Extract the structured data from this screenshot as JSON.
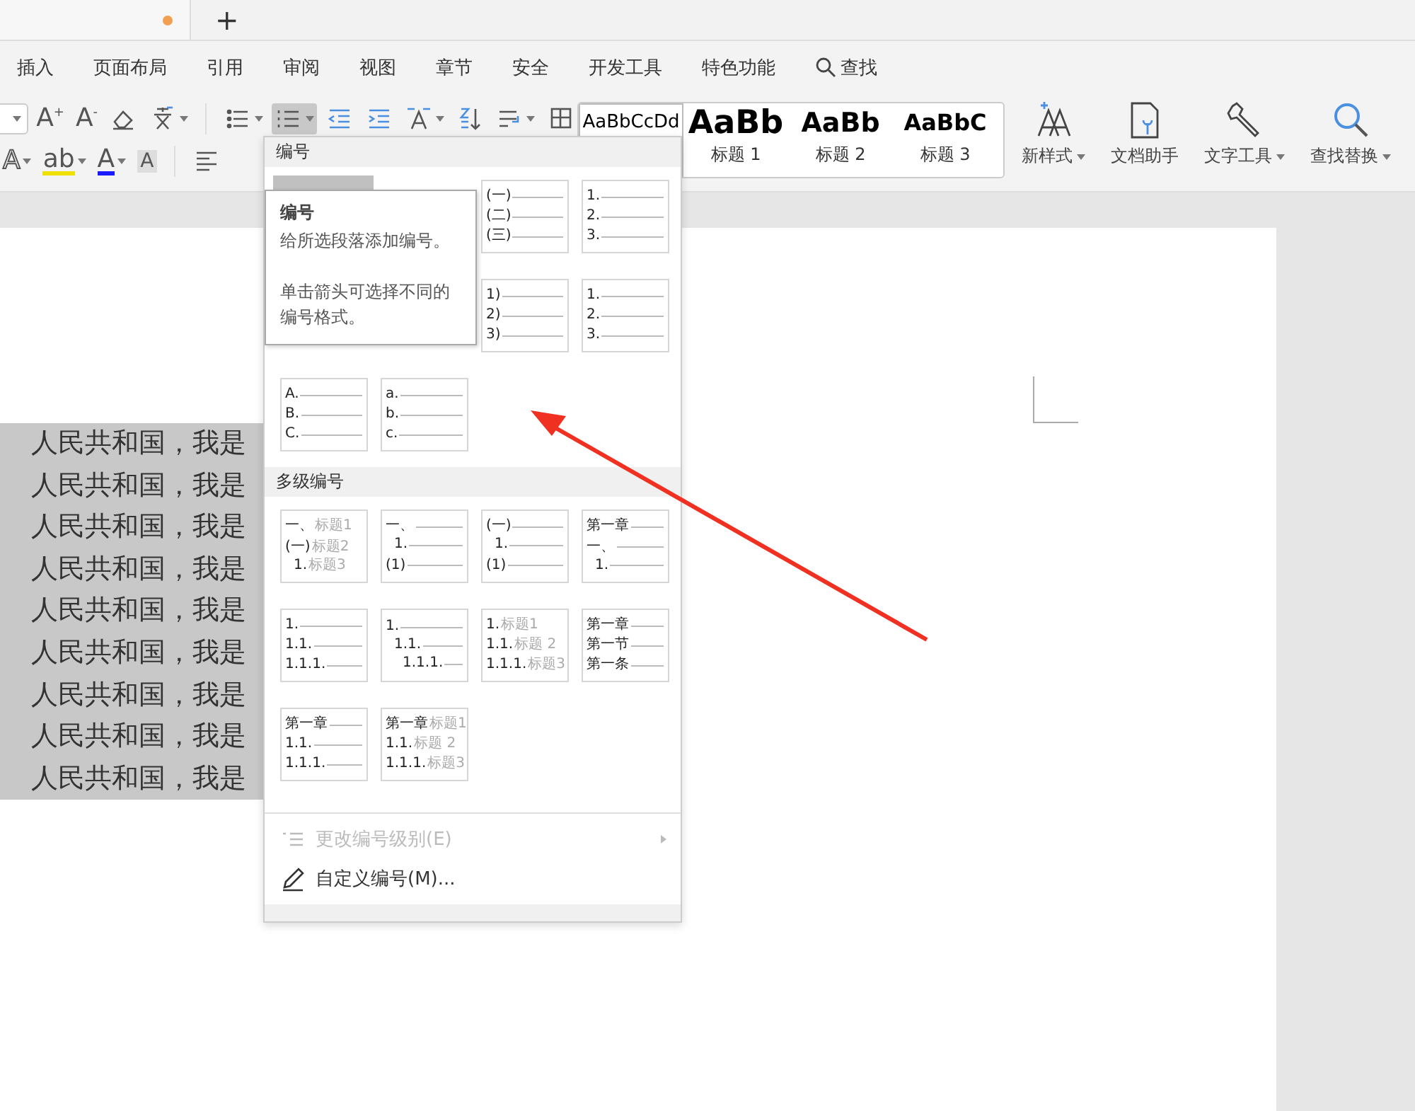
{
  "tab_bar": {
    "document_tab": {
      "modified": true
    },
    "new_tab": "+"
  },
  "menu": [
    {
      "label": "插入",
      "kind": "text"
    },
    {
      "label": "页面布局",
      "kind": "text"
    },
    {
      "label": "引用",
      "kind": "text"
    },
    {
      "label": "审阅",
      "kind": "text"
    },
    {
      "label": "视图",
      "kind": "text"
    },
    {
      "label": "章节",
      "kind": "text"
    },
    {
      "label": "安全",
      "kind": "text"
    },
    {
      "label": "开发工具",
      "kind": "text"
    },
    {
      "label": "特色功能",
      "kind": "text"
    },
    {
      "label": "查找",
      "kind": "search"
    }
  ],
  "toolbar": {
    "glyphs": [
      "A$^{+}$",
      "A$^{-}$",
      "A",
      "ab",
      "A",
      "A"
    ],
    "list_buttons": [
      {
        "pressed": false
      },
      {
        "pressed": true
      }
    ],
    "styles": [
      {
        "sample": "AaBbCcDd"
      },
      {
        "sample": "AaBb",
        "name": "标题 1"
      },
      {
        "sample": "AaBb",
        "name": "标题 2"
      },
      {
        "sample": "AaBbC",
        "name": "标题 3"
      }
    ],
    "tools": [
      {
        "label": "新样式",
        "dropdown": true
      },
      {
        "label": "文档助手",
        "dropdown": false
      },
      {
        "label": "文字工具",
        "dropdown": true
      },
      {
        "label": "查找替换",
        "dropdown": true
      }
    ]
  },
  "document": {
    "selected": true,
    "lines": [
      "人民共和国，我是",
      "人民共和国，我是",
      "人民共和国，我是",
      "人民共和国，我是",
      "人民共和国，我是",
      "人民共和国，我是",
      "人民共和国，我是",
      "人民共和国，我是",
      "人民共和国，我是"
    ]
  },
  "numbering_menu": {
    "title": "编号",
    "numbering": [
      {
        "hovered": true
      },
      {
        "hovered": false
      },
      {
        "hovered": false,
        "lines": [
          {
            "label": "(一)"
          },
          {
            "label": "(二)"
          },
          {
            "label": "(三)"
          }
        ]
      },
      {
        "hovered": false,
        "lines": [
          {
            "label": "1."
          },
          {
            "label": "2."
          },
          {
            "label": "3."
          }
        ]
      },
      {
        "hovered": false
      },
      {
        "hovered": false
      },
      {
        "hovered": false,
        "lines": [
          {
            "label": "1)"
          },
          {
            "label": "2)"
          },
          {
            "label": "3)"
          }
        ]
      },
      {
        "hovered": false,
        "lines": [
          {
            "label": "1."
          },
          {
            "label": "2."
          },
          {
            "label": "3."
          }
        ]
      },
      {
        "hovered": false,
        "lines": [
          {
            "label": "A."
          },
          {
            "label": "B."
          },
          {
            "label": "C."
          }
        ]
      },
      {
        "hovered": false,
        "lines": [
          {
            "label": "a."
          },
          {
            "label": "b."
          },
          {
            "label": "c."
          }
        ]
      }
    ],
    "multilevel_title": "多级编号",
    "multilevel": [
      {
        "lines": [
          {
            "label": "一、",
            "caption": "标题1"
          },
          {
            "label": "(一)",
            "caption": "标题2",
            "children": [
              {
                "label": "1.",
                "caption": "标题3"
              }
            ]
          }
        ]
      },
      {
        "lines": [
          {
            "label": "一、",
            "children": [
              {
                "label": "1."
              }
            ]
          },
          {
            "label": "(1)"
          }
        ]
      },
      {
        "lines": [
          {
            "label": "(一)",
            "children": [
              {
                "label": "1."
              }
            ]
          },
          {
            "label": "(1)"
          }
        ]
      },
      {
        "lines": [
          {
            "label": "第一章"
          },
          {
            "label": "一、",
            "children": [
              {
                "label": "1."
              }
            ]
          }
        ]
      },
      {
        "lines": [
          {
            "label": "1."
          },
          {
            "label": "1.1."
          },
          {
            "label": "1.1.1."
          }
        ]
      },
      {
        "lines": [
          {
            "label": "1.",
            "children": [
              {
                "label": "1.1.",
                "children": [
                  {
                    "label": "1.1.1."
                  }
                ]
              }
            ]
          }
        ]
      },
      {
        "lines": [
          {
            "label": "1.",
            "caption": "标题1"
          },
          {
            "label": "1.1.",
            "caption": "标题 2"
          },
          {
            "label": "1.1.1.",
            "caption": "标题3"
          }
        ]
      },
      {
        "lines": [
          {
            "label": "第一章"
          },
          {
            "label": "第一节"
          },
          {
            "label": "第一条"
          }
        ]
      },
      {
        "lines": [
          {
            "label": "第一章"
          },
          {
            "label": "1.1."
          },
          {
            "label": "1.1.1."
          }
        ]
      },
      {
        "lines": [
          {
            "label": "第一章",
            "caption": "标题1"
          },
          {
            "label": "1.1.",
            "caption": "标题 2"
          },
          {
            "label": "1.1.1.",
            "caption": "标题3"
          }
        ]
      }
    ],
    "items": [
      {
        "label": "更改编号级别(E)",
        "disabled": true,
        "submenu": true
      },
      {
        "label": "自定义编号(M)...",
        "disabled": false,
        "submenu": false
      }
    ]
  },
  "tooltip": {
    "title": "编号",
    "paragraphs": [
      "给所选段落添加编号。",
      "单击箭头可选择不同的编号格式。"
    ]
  }
}
